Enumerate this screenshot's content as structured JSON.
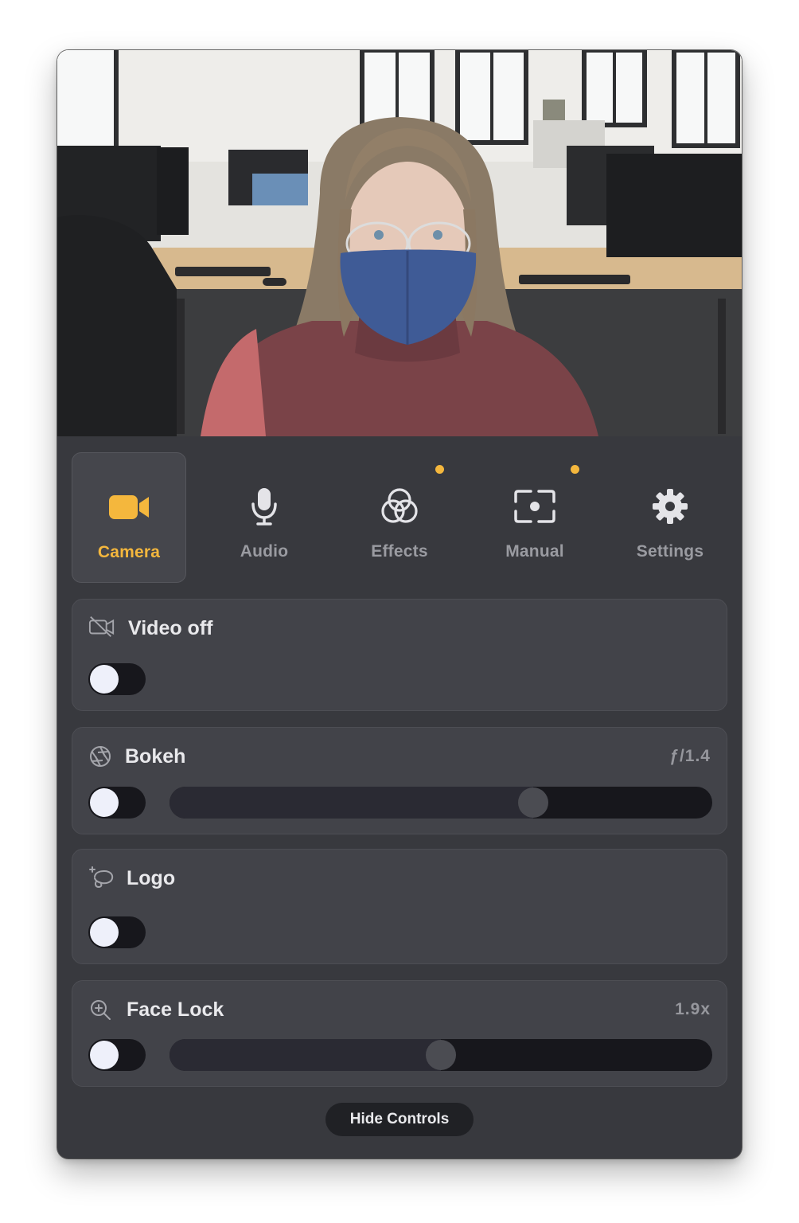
{
  "colors": {
    "accent": "#f4b73d",
    "panel": "#38393e",
    "card": "#424349",
    "track": "#17171c",
    "inactive_label": "#9a9ba1"
  },
  "tabs": [
    {
      "label": "Camera",
      "icon": "video-camera-icon",
      "active": true,
      "indicator": false
    },
    {
      "label": "Audio",
      "icon": "microphone-icon",
      "active": false,
      "indicator": false
    },
    {
      "label": "Effects",
      "icon": "color-circles-icon",
      "active": false,
      "indicator": true
    },
    {
      "label": "Manual",
      "icon": "focus-frame-icon",
      "active": false,
      "indicator": true
    },
    {
      "label": "Settings",
      "icon": "gear-icon",
      "active": false,
      "indicator": false
    }
  ],
  "controls": {
    "video_off": {
      "title": "Video off",
      "icon": "video-off-icon",
      "enabled": false
    },
    "bokeh": {
      "title": "Bokeh",
      "value": "ƒ/1.4",
      "icon": "aperture-icon",
      "enabled": false,
      "level": 0.67
    },
    "logo": {
      "title": "Logo",
      "icon": "logo-lasso-icon",
      "enabled": false
    },
    "face_lock": {
      "title": "Face Lock",
      "value": "1.9x",
      "icon": "zoom-in-icon",
      "enabled": false,
      "level": 0.5
    }
  },
  "footer": {
    "hide_label": "Hide Controls"
  }
}
